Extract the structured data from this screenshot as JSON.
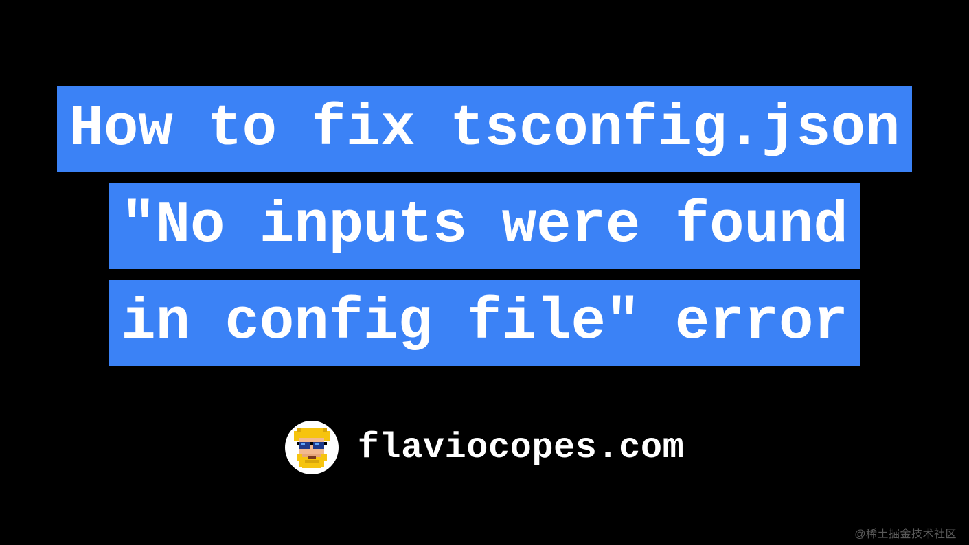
{
  "title": {
    "lines": [
      "How to fix tsconfig.json",
      "\"No inputs were found",
      "in config file\" error"
    ]
  },
  "author": {
    "domain": "flaviocopes.com"
  },
  "watermark": "@稀土掘金技术社区",
  "colors": {
    "highlight_bg": "#3b82f6",
    "text": "#ffffff",
    "background": "#000000"
  }
}
